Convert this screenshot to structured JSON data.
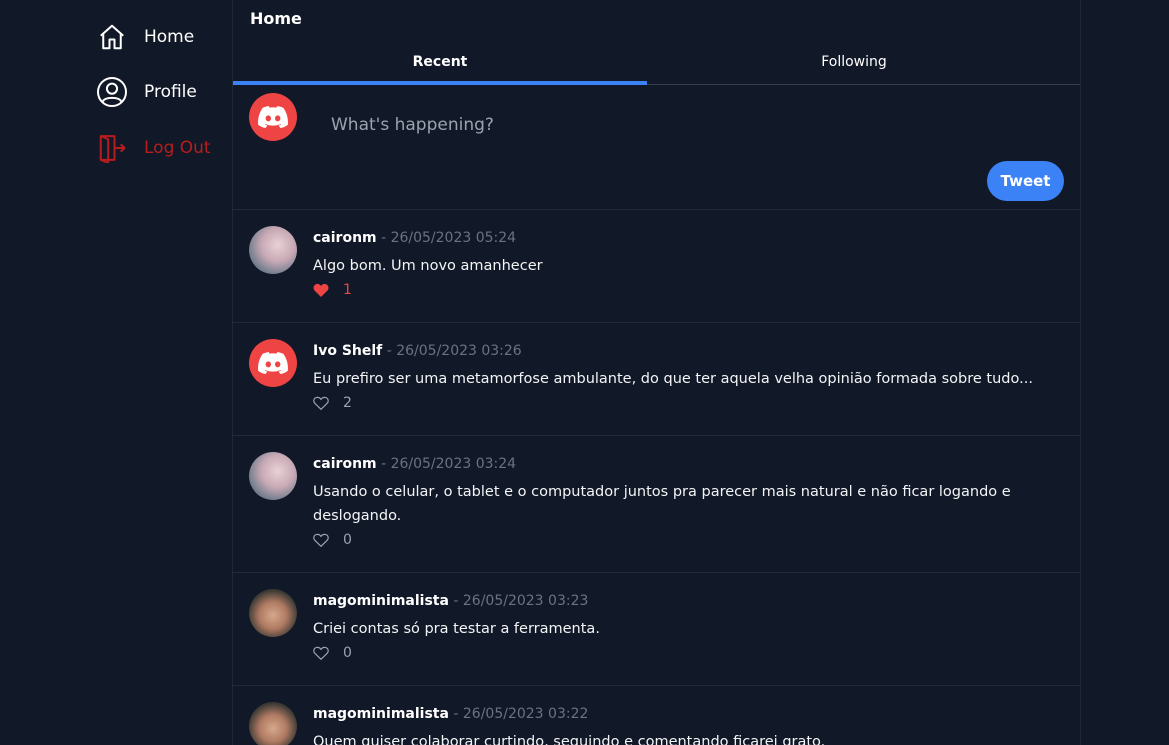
{
  "sidebar": {
    "items": [
      {
        "label": "Home",
        "icon": "home-icon"
      },
      {
        "label": "Profile",
        "icon": "user-circle-icon"
      },
      {
        "label": "Log Out",
        "icon": "logout-icon",
        "color": "#b91c1c"
      }
    ]
  },
  "header": {
    "title": "Home"
  },
  "tabs": [
    {
      "label": "Recent",
      "active": true
    },
    {
      "label": "Following",
      "active": false
    }
  ],
  "composer": {
    "placeholder": "What's happening?",
    "button_label": "Tweet"
  },
  "posts": [
    {
      "user": "caironm",
      "separator": " - ",
      "date": "26/05/2023 05:24",
      "text": "Algo bom. Um novo amanhecer",
      "likes": "1",
      "liked": true,
      "avatar": "photo"
    },
    {
      "user": "Ivo Shelf",
      "separator": " - ",
      "date": "26/05/2023 03:26",
      "text": "Eu prefiro ser uma metamorfose ambulante, do que ter aquela velha opinião formada sobre tudo...",
      "likes": "2",
      "liked": false,
      "avatar": "discord-logo"
    },
    {
      "user": "caironm",
      "separator": " - ",
      "date": "26/05/2023 03:24",
      "text": "Usando o celular, o tablet e o computador juntos pra parecer mais natural e não ficar logando e deslogando.",
      "likes": "0",
      "liked": false,
      "avatar": "photo"
    },
    {
      "user": "magominimalista",
      "separator": " - ",
      "date": "26/05/2023 03:23",
      "text": "Criei contas só pra testar a ferramenta.",
      "likes": "0",
      "liked": false,
      "avatar": "photo"
    },
    {
      "user": "magominimalista",
      "separator": " - ",
      "date": "26/05/2023 03:22",
      "text": "Quem quiser colaborar curtindo, seguindo e comentando ficarei grato.",
      "likes": "",
      "liked": false,
      "avatar": "photo"
    }
  ],
  "colors": {
    "background": "#111827",
    "accent": "#3b82f6",
    "like": "#ef4444",
    "logout": "#b91c1c"
  }
}
